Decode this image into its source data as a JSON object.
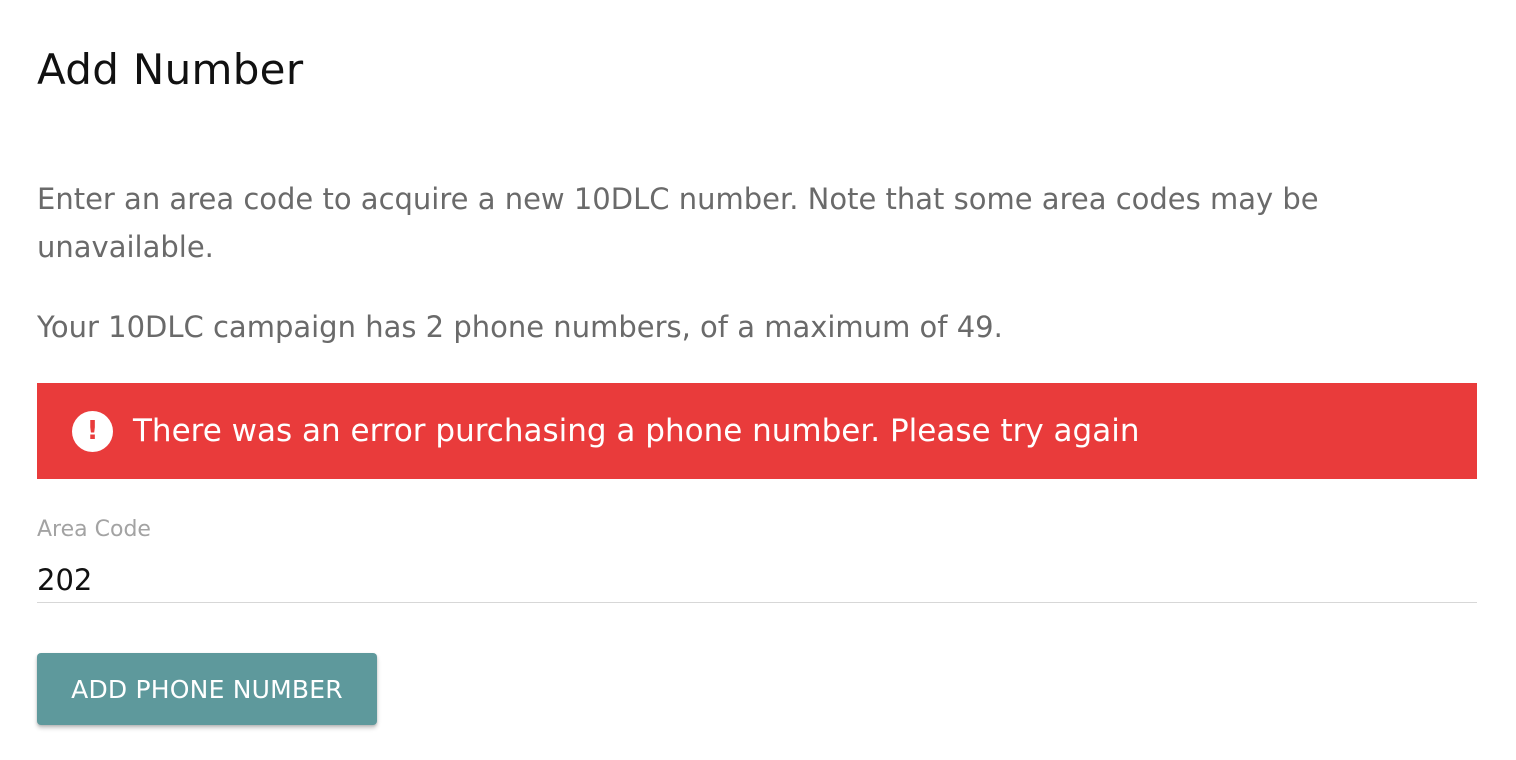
{
  "page": {
    "title": "Add Number",
    "description": "Enter an area code to acquire a new 10DLC number. Note that some area codes may be unavailable.",
    "campaign_status": "Your 10DLC campaign has 2 phone numbers, of a maximum of 49."
  },
  "error": {
    "icon": "exclamation-circle-icon",
    "icon_glyph": "!",
    "message": "There was an error purchasing a phone number. Please try again",
    "color": "#e93b3b"
  },
  "form": {
    "area_code": {
      "label": "Area Code",
      "value": "202"
    },
    "submit_label": "ADD PHONE NUMBER",
    "submit_color": "#5e999c"
  }
}
